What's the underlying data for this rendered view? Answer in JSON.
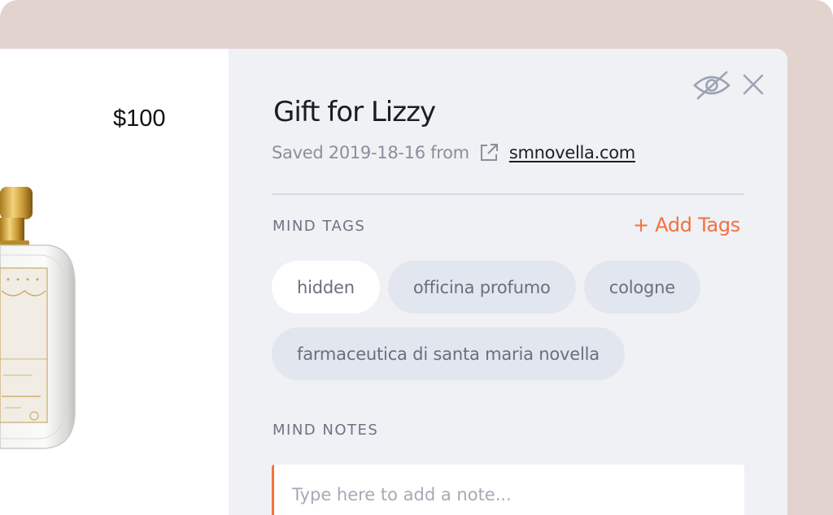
{
  "product": {
    "price": "$100",
    "image_icon": "perfume-bottle-image"
  },
  "panel": {
    "title": "Gift for Lizzy",
    "saved_text": "Saved 2019-18-16 from",
    "site_link": "smnovella.com",
    "hide_icon": "eye-off-icon",
    "close_icon": "close-icon",
    "external_link_icon": "external-link-icon"
  },
  "tags_section": {
    "label": "MIND TAGS",
    "add_label": "+ Add Tags",
    "tags": [
      {
        "label": "hidden",
        "active": true
      },
      {
        "label": "officina profumo",
        "active": false
      },
      {
        "label": "cologne",
        "active": false
      },
      {
        "label": "farmaceutica di santa maria novella",
        "active": false
      }
    ]
  },
  "notes_section": {
    "label": "MIND NOTES",
    "placeholder": "Type here to add a note..."
  },
  "colors": {
    "accent": "#f2723f",
    "backdrop": "#e2d3cf",
    "panel_bg": "#eff1f5",
    "tag_bg": "#e2e6ee"
  }
}
